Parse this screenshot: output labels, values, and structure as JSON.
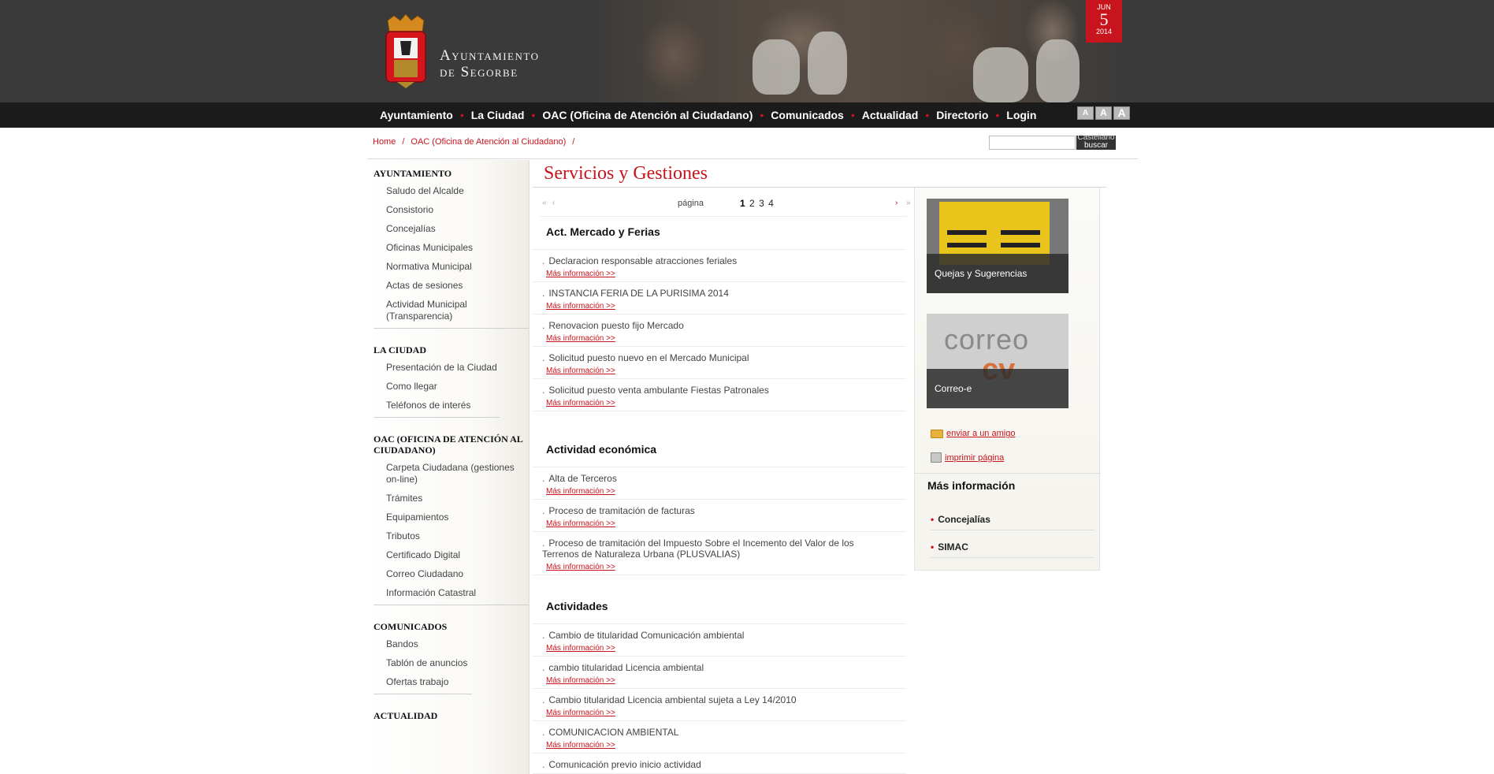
{
  "header": {
    "brand_line1": "Ayuntamiento",
    "brand_line2": "de Segorbe",
    "date": {
      "month": "JUN",
      "day": "5",
      "year": "2014"
    }
  },
  "nav": {
    "items": [
      "Ayuntamiento",
      "La Ciudad",
      "OAC (Oficina de Atención al Ciudadano)",
      "Comunicados",
      "Actualidad",
      "Directorio",
      "Login"
    ],
    "font_buttons": [
      "A",
      "A",
      "A"
    ]
  },
  "breadcrumb": [
    "Home",
    "OAC (Oficina de Atención al Ciudadano)"
  ],
  "breadcrumb_separator": "/",
  "search": {
    "language": "Castellano",
    "button": "buscar"
  },
  "sidebar": {
    "groups": [
      {
        "title": "Ayuntamiento",
        "items": [
          "Saludo del Alcalde",
          "Consistorio",
          "Concejalías",
          "Oficinas Municipales",
          "Normativa Municipal",
          "Actas de sesiones",
          "Actividad Municipal (Transparencia)"
        ]
      },
      {
        "title": "La Ciudad",
        "items": [
          "Presentación de la Ciudad",
          "Como llegar",
          "Teléfonos de interés"
        ]
      },
      {
        "title": "OAC (Oficina de Atención al Ciudadano)",
        "items": [
          "Carpeta Ciudadana (gestiones on-line)",
          "Trámites",
          "Equipamientos",
          "Tributos",
          "Certificado Digital",
          "Correo Ciudadano",
          "Información Catastral"
        ]
      },
      {
        "title": "Comunicados",
        "items": [
          "Bandos",
          "Tablón de anuncios",
          "Ofertas trabajo"
        ]
      },
      {
        "title": "Actualidad",
        "items": []
      }
    ]
  },
  "main": {
    "title": "Servicios y Gestiones",
    "pager": {
      "label": "página",
      "pages": [
        "1",
        "2",
        "3",
        "4"
      ],
      "first": "«",
      "prev": "‹",
      "next": "›",
      "last": "»"
    },
    "more_label": "Más información >>",
    "sections": [
      {
        "title": "Act. Mercado y Ferias",
        "entries": [
          "Declaracion responsable atracciones feriales",
          "INSTANCIA FERIA DE LA PURISIMA 2014",
          "Renovacion puesto fijo Mercado",
          "Solicitud puesto nuevo en el Mercado Municipal",
          "Solicitud puesto venta ambulante Fiestas Patronales"
        ]
      },
      {
        "title": "Actividad económica",
        "entries": [
          "Alta de Terceros",
          "Proceso de tramitación de facturas",
          "Proceso de tramitación del Impuesto Sobre el Incemento del Valor de los Terrenos de Naturaleza Urbana (PLUSVALIAS)"
        ]
      },
      {
        "title": "Actividades",
        "entries": [
          "Cambio de titularidad Comunicación ambiental",
          "cambio titularidad Licencia ambiental",
          "Cambio titularidad Licencia ambiental sujeta a Ley 14/2010",
          "COMUNICACION AMBIENTAL",
          "Comunicación previo inicio actividad"
        ]
      }
    ]
  },
  "right": {
    "promos": [
      "Quejas y Sugerencias",
      "Correo-e"
    ],
    "correo_word": "correo",
    "correo_cv": "cv",
    "send_friend": "enviar a un amigo",
    "print_page": "imprimir página",
    "more_info_title": "Más información",
    "more_info_items": [
      "Concejalías",
      "SIMAC"
    ]
  }
}
